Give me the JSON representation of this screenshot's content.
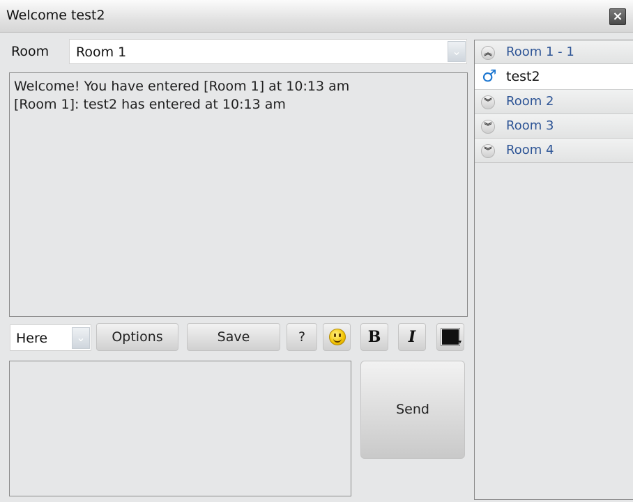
{
  "window": {
    "title": "Welcome test2",
    "close_icon": "close-icon"
  },
  "room_selector": {
    "label": "Room",
    "value": "Room 1"
  },
  "chat_log": {
    "lines": [
      "Welcome! You have entered [Room 1] at 10:13 am",
      "[Room 1]: test2 has entered at 10:13 am"
    ]
  },
  "toolbar": {
    "target_value": "Here",
    "options_label": "Options",
    "save_label": "Save",
    "help_label": "?",
    "emoticon_icon": "smiley-icon",
    "bold_label": "B",
    "italic_label": "I",
    "text_color": "#111111"
  },
  "message_input": {
    "value": ""
  },
  "send_label": "Send",
  "rooms_panel": {
    "rooms": [
      {
        "name": "Room 1 - 1",
        "expanded": true,
        "users": [
          {
            "name": "test2",
            "gender_icon": "male-icon"
          }
        ]
      },
      {
        "name": "Room 2",
        "expanded": false,
        "users": []
      },
      {
        "name": "Room 3",
        "expanded": false,
        "users": []
      },
      {
        "name": "Room 4",
        "expanded": false,
        "users": []
      }
    ]
  },
  "colors": {
    "room_link": "#2e5596",
    "male_icon": "#1a75d0",
    "background": "#e6e7e8"
  }
}
